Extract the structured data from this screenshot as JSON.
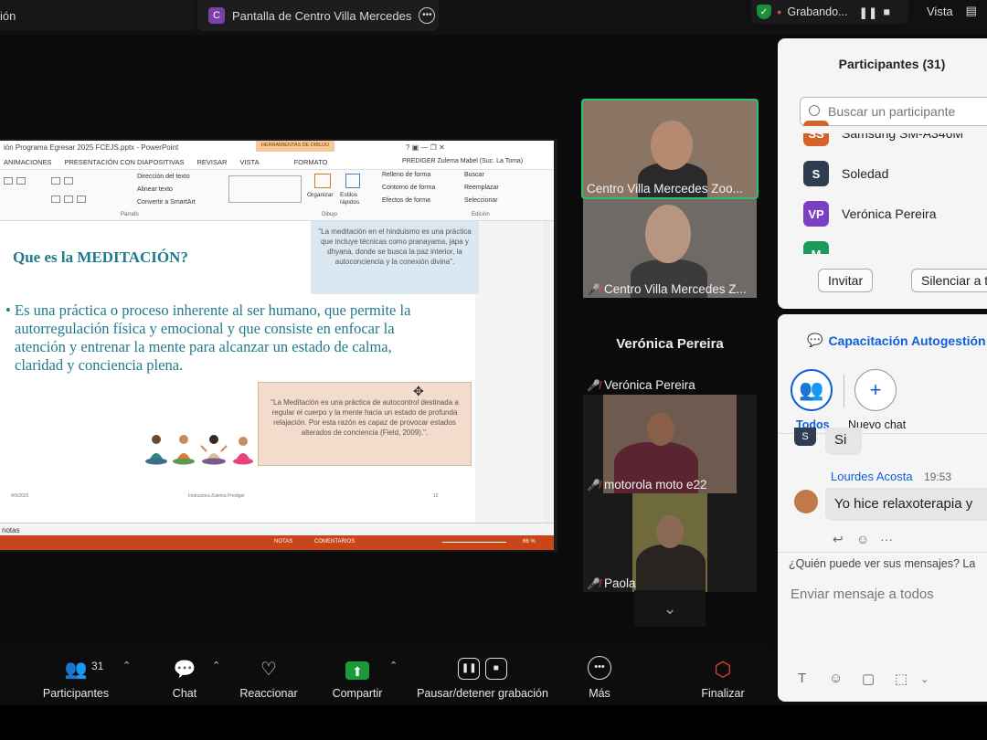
{
  "topbar": {
    "left_tab": "ión",
    "share_badge": "C",
    "share_title": "Pantalla de Centro Villa Mercedes",
    "recording_label": "Grabando...",
    "view_label": "Vista"
  },
  "ppt": {
    "window_title": "ión Programa Egresar  2025 FCEJS.pptx - PowerPoint",
    "context_tab": "HERRAMIENTAS DE DIBUJO",
    "window_tools": "?   ▣   —   ❐   ✕",
    "tabs": [
      "ANIMACIONES",
      "PRESENTACIÓN CON DIAPOSITIVAS",
      "REVISAR",
      "VISTA",
      "FORMATO"
    ],
    "user": "PREDIGER Zulema Mabel (Suc. La Toma)",
    "ribbon": {
      "direction": "Dirección del texto",
      "align": "Alinear texto",
      "smartart": "Convertir a SmartArt",
      "organize": "Organizar",
      "styles": "Estilos rápidos",
      "fill": "Relleno de forma",
      "outline": "Contorno de forma",
      "effects": "Efectos de forma",
      "search": "Buscar",
      "replace": "Reemplazar",
      "select": "Seleccionar",
      "group_paragraph": "Párrafo",
      "group_draw": "Dibujo",
      "group_edit": "Edición"
    },
    "slide": {
      "heading": "Que es la MEDITACIÓN?",
      "bullet": "•",
      "body": "Es una práctica o proceso inherente al ser humano, que permite la autorregulación física y emocional y que consiste en enfocar la atención y entrenar la mente para alcanzar un estado de calma, claridad y conciencia plena.",
      "quote_top": "\"La meditación en el hinduismo es una práctica que incluye técnicas como pranayama, japa y dhyana, donde se busca la paz interior, la autoconciencia y la conexión divina\".",
      "quote_bottom": "\"La Meditación es una práctica de autocontrol destinada a regular el cuerpo y la mente hacia un estado de profunda relajación. Por esta razón es capaz de provocar estados alterados de conciencia (Field, 2009).\".",
      "footer_date": "4/9/2025",
      "footer_author": "Instructora Zulema Prediger",
      "footer_page": "12"
    },
    "notes_label": "notas",
    "status": {
      "notes": "NOTAS",
      "comments": "COMENTARIOS",
      "zoom": "66 %"
    }
  },
  "videos": [
    {
      "label": "Centro Villa Mercedes Zoo...",
      "muted": false
    },
    {
      "label": "Centro Villa Mercedes Z...",
      "muted": true
    },
    {
      "label": "Verónica Pereira",
      "muted": true
    },
    {
      "label": "motorola moto e22",
      "muted": true
    },
    {
      "label": "Paola",
      "muted": true
    }
  ],
  "speaker_name": "Verónica Pereira",
  "participants": {
    "title": "Participantes (31)",
    "search_placeholder": "Buscar un participante",
    "list": [
      {
        "initials": "SS",
        "name": "Samsung SM-A346M",
        "color": "#d4622a"
      },
      {
        "initials": "S",
        "name": "Soledad",
        "color": "#2f3d52"
      },
      {
        "initials": "VP",
        "name": "Verónica Pereira",
        "color": "#7b3fc4"
      },
      {
        "initials": "M",
        "name": "",
        "color": "#1c9a5c"
      }
    ],
    "invite_button": "Invitar",
    "mute_all_button": "Silenciar a t"
  },
  "chat": {
    "title": "Capacitación Autogestión",
    "tabs": [
      {
        "label": "Todos",
        "icon": "group-icon"
      },
      {
        "label": "Nuevo chat",
        "icon": "plus-icon"
      }
    ],
    "messages": [
      {
        "avatar": "S",
        "sender": "",
        "time": "",
        "text": "Si"
      },
      {
        "avatar": "",
        "sender": "Lourdes Acosta",
        "time": "19:53",
        "text": "Yo hice relaxoterapia y"
      }
    ],
    "visibility_note": "¿Quién puede ver sus mensajes? La",
    "input_placeholder": "Enviar mensaje a todos"
  },
  "toolbar": {
    "participants_label": "Participantes",
    "participants_count": "31",
    "chat_label": "Chat",
    "react_label": "Reaccionar",
    "share_label": "Compartir",
    "record_label": "Pausar/detener grabación",
    "more_label": "Más",
    "end_label": "Finalizar"
  },
  "colors": {
    "active_speaker_border": "#2ec06e",
    "share_button": "#1a9a3a",
    "end_button": "#e0443a",
    "chat_accent": "#0e5fd8"
  }
}
